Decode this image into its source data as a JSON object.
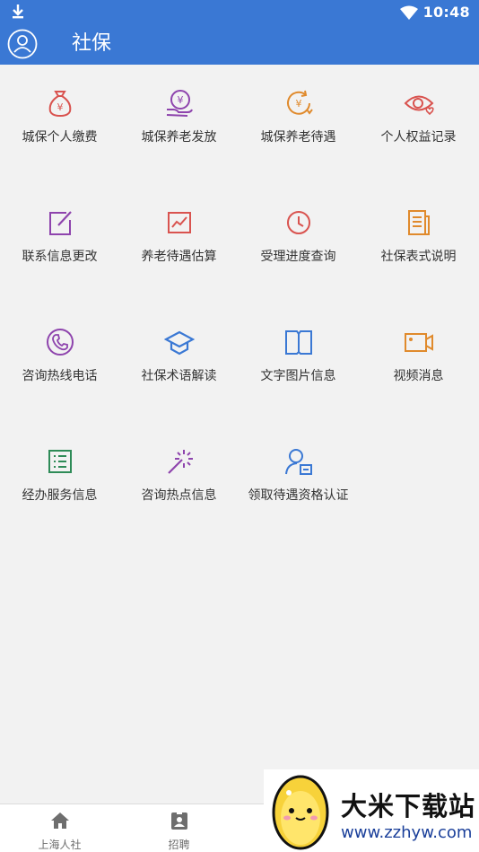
{
  "status_bar": {
    "time": "10:48"
  },
  "app_bar": {
    "title": "社保"
  },
  "grid_items": [
    {
      "label": "城保个人缴费",
      "icon": "money-bag-icon",
      "color": "#d9534f"
    },
    {
      "label": "城保养老发放",
      "icon": "yuan-hand-icon",
      "color": "#8e44ad"
    },
    {
      "label": "城保养老待遇",
      "icon": "yuan-refresh-icon",
      "color": "#e08a2c"
    },
    {
      "label": "个人权益记录",
      "icon": "eye-heart-icon",
      "color": "#d9534f"
    },
    {
      "label": "联系信息更改",
      "icon": "edit-icon",
      "color": "#8e44ad"
    },
    {
      "label": "养老待遇估算",
      "icon": "chart-icon",
      "color": "#d9534f"
    },
    {
      "label": "受理进度查询",
      "icon": "clock-icon",
      "color": "#d9534f"
    },
    {
      "label": "社保表式说明",
      "icon": "document-icon",
      "color": "#e08a2c"
    },
    {
      "label": "咨询热线电话",
      "icon": "phone-icon",
      "color": "#8e44ad"
    },
    {
      "label": "社保术语解读",
      "icon": "graduation-cap-icon",
      "color": "#3a78d4"
    },
    {
      "label": "文字图片信息",
      "icon": "book-icon",
      "color": "#3a78d4"
    },
    {
      "label": "视频消息",
      "icon": "video-icon",
      "color": "#e08a2c"
    },
    {
      "label": "经办服务信息",
      "icon": "list-icon",
      "color": "#2e8b57"
    },
    {
      "label": "咨询热点信息",
      "icon": "magic-wand-icon",
      "color": "#8e44ad"
    },
    {
      "label": "领取待遇资格认证",
      "icon": "user-card-icon",
      "color": "#3a78d4"
    }
  ],
  "bottom_nav": [
    {
      "label": "上海人社",
      "icon": "home-icon"
    },
    {
      "label": "招聘",
      "icon": "badge-icon"
    }
  ],
  "watermark": {
    "title": "大米下载站",
    "url": "www.zzhyw.com"
  }
}
